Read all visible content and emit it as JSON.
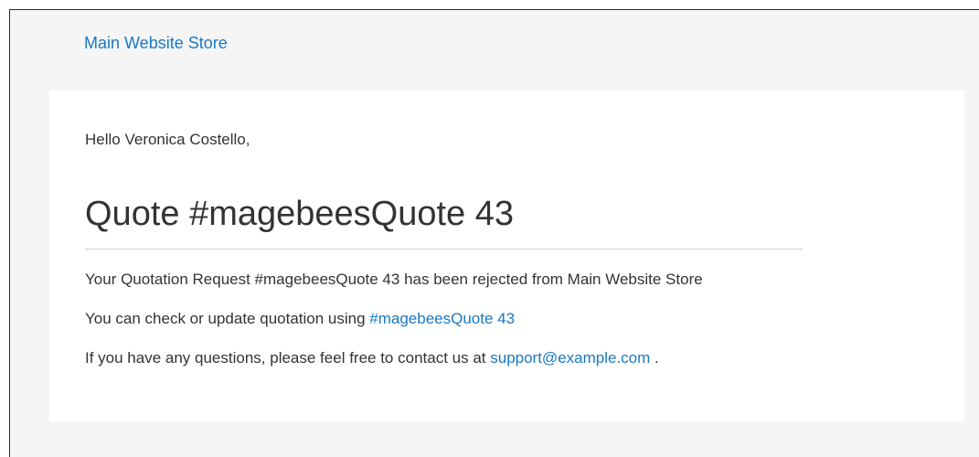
{
  "header": {
    "store_link": "Main Website Store"
  },
  "email": {
    "greeting": "Hello Veronica Costello,",
    "title": "Quote #magebeesQuote 43",
    "line1": "Your Quotation Request #magebeesQuote 43 has been rejected from Main Website Store",
    "line2_prefix": "You can check or update quotation using ",
    "line2_link": "#magebeesQuote 43",
    "line3_prefix": "If you have any questions, please feel free to contact us at ",
    "line3_link": "support@example.com",
    "line3_suffix": " ."
  },
  "colors": {
    "link": "#1979c3",
    "text": "#333333",
    "background": "#f5f5f5",
    "card": "#ffffff"
  }
}
